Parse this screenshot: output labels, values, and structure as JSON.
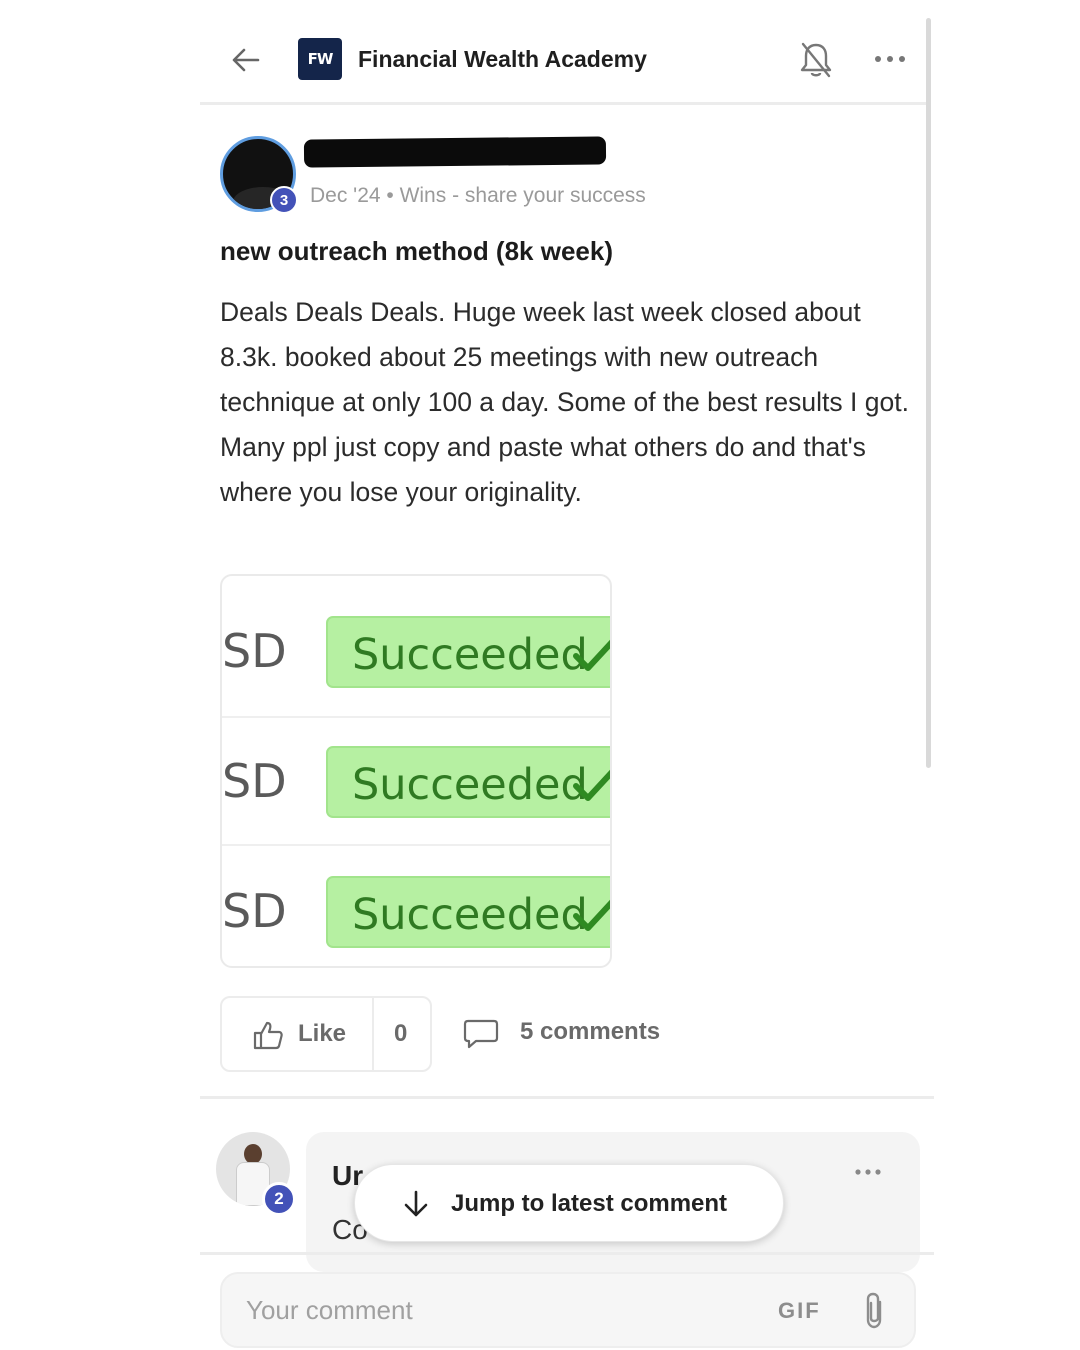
{
  "header": {
    "back_icon": "arrow-left-icon",
    "logo_text": "FW",
    "group_name": "Financial Wealth Academy",
    "bell_icon": "bell-off-icon",
    "more_icon": "more-horizontal-icon"
  },
  "post": {
    "author_level": "3",
    "meta": "Dec '24 • Wins - share your success",
    "title": "new outreach method (8k week)",
    "body": "Deals Deals Deals. Huge week last week closed about 8.3k. booked about 25 meetings with new outreach technique at only 100 a day. Some of the best results I got. Many ppl just copy and paste what others do and that's where you lose your originality.",
    "attachment": {
      "rows": [
        {
          "currency": "SD",
          "status": "Succeeded"
        },
        {
          "currency": "SD",
          "status": "Succeeded"
        },
        {
          "currency": "SD",
          "status": "Succeeded"
        }
      ],
      "status_color": "#b6f0a2",
      "status_text_color": "#2f7a22"
    }
  },
  "actions": {
    "like_label": "Like",
    "like_count": "0",
    "comments_label": "5 comments"
  },
  "comment": {
    "author_partial": "Ur",
    "text_partial": "Co",
    "level": "2"
  },
  "jump_button": {
    "label": "Jump to latest comment"
  },
  "composer": {
    "placeholder": "Your comment",
    "gif_label": "GIF",
    "attach_icon": "paperclip-icon"
  },
  "colors": {
    "badge": "#4352b8",
    "logo_bg": "#14254a",
    "avatar_ring": "#5f9de0"
  }
}
